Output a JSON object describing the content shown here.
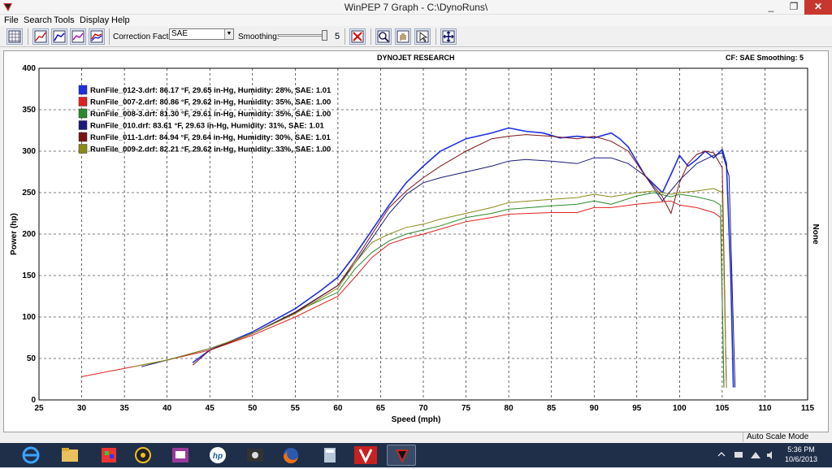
{
  "window": {
    "title": "WinPEP 7     Graph - C:\\DynoRuns\\",
    "min_glyph": "_",
    "max_glyph": "❐",
    "close_glyph": "✕"
  },
  "menu": [
    "File",
    "Search",
    "Tools",
    "Display",
    "Help"
  ],
  "toolbar": {
    "correction_label": "Correction Factor:",
    "correction_value": "SAE",
    "smoothing_label": "Smoothing:",
    "smoothing_value": "5"
  },
  "graph_header": {
    "center": "DYNOJET RESEARCH",
    "right": "CF: SAE  Smoothing: 5",
    "right_axis_label": "None"
  },
  "status": {
    "mode": "Auto Scale Mode"
  },
  "tray": {
    "time": "5:36 PM",
    "date": "10/6/2013"
  },
  "colors": {
    "blue": "#1e2ee0",
    "red": "#e02020",
    "green": "#2a8a2a",
    "navy": "#1a1a7a",
    "maroon": "#7a1414",
    "olive": "#8a8a18"
  },
  "icons": [
    "grid-icon",
    "graph-icon",
    "graph-icon",
    "graph-icon",
    "graph-icon",
    "delete-icon",
    "zoom-icon",
    "hand-icon",
    "cursor-icon",
    "move-icon"
  ],
  "chart_data": {
    "type": "line",
    "title": "",
    "xlabel": "Speed (mph)",
    "ylabel": "Power (hp)",
    "xlim": [
      25,
      115
    ],
    "ylim": [
      0,
      400
    ],
    "x_ticks": [
      25,
      30,
      35,
      40,
      45,
      50,
      55,
      60,
      65,
      70,
      75,
      80,
      85,
      90,
      95,
      100,
      105,
      110,
      115
    ],
    "y_ticks": [
      0,
      50,
      100,
      150,
      200,
      250,
      300,
      350,
      400
    ],
    "grid": true,
    "legend_position": "top-left",
    "series": [
      {
        "name": "RunFile_012-3.drf: 86.17 °F, 29.65 in-Hg, Humidity: 28%, SAE: 1.01",
        "color": "#1e2ee0",
        "x": [
          43,
          45,
          50,
          55,
          58,
          60,
          62,
          64,
          66,
          68,
          70,
          72,
          75,
          78,
          80,
          82,
          84,
          86,
          88,
          90,
          92,
          93,
          94,
          96,
          98,
          99,
          100,
          101,
          102,
          103,
          104,
          105,
          105.5,
          106,
          106.3
        ],
        "y": [
          45,
          60,
          82,
          110,
          132,
          148,
          175,
          205,
          235,
          262,
          282,
          300,
          315,
          322,
          328,
          324,
          322,
          316,
          318,
          316,
          322,
          315,
          305,
          270,
          250,
          272,
          295,
          282,
          290,
          300,
          292,
          302,
          285,
          150,
          15
        ]
      },
      {
        "name": "RunFile_007-2.drf: 80.86 °F, 29.62 in-Hg, Humidity: 35%, SAE: 1.00",
        "color": "#e02020",
        "x": [
          30,
          35,
          40,
          45,
          50,
          55,
          60,
          62,
          64,
          66,
          68,
          70,
          72,
          75,
          78,
          80,
          85,
          88,
          90,
          92,
          95,
          97,
          99,
          100,
          102,
          104,
          104.8,
          105.2
        ],
        "y": [
          28,
          38,
          48,
          60,
          78,
          100,
          125,
          148,
          172,
          188,
          195,
          200,
          206,
          215,
          220,
          224,
          226,
          226,
          232,
          232,
          236,
          238,
          240,
          235,
          232,
          226,
          220,
          15
        ]
      },
      {
        "name": "RunFile_008-3.drf: 81.30 °F, 29.61 in-Hg, Humidity: 35%, SAE: 1.00",
        "color": "#2a8a2a",
        "x": [
          37,
          40,
          45,
          50,
          55,
          60,
          62,
          64,
          66,
          68,
          70,
          72,
          75,
          78,
          80,
          85,
          88,
          90,
          92,
          95,
          97,
          99,
          100,
          102,
          104,
          104.8,
          105.2
        ],
        "y": [
          42,
          48,
          62,
          80,
          106,
          130,
          158,
          178,
          192,
          200,
          205,
          210,
          220,
          225,
          230,
          234,
          236,
          240,
          236,
          246,
          250,
          245,
          248,
          245,
          240,
          235,
          15
        ]
      },
      {
        "name": "RunFile_010.drf: 83.61 °F, 29.63 in-Hg, Humidity: 31%, SAE: 1.01",
        "color": "#1a1a7a",
        "x": [
          37,
          40,
          45,
          50,
          55,
          60,
          62,
          64,
          66,
          68,
          70,
          72,
          75,
          78,
          80,
          82,
          85,
          88,
          90,
          92,
          94,
          96,
          98,
          100,
          102,
          104,
          105,
          105.8,
          106.5
        ],
        "y": [
          40,
          48,
          62,
          80,
          106,
          138,
          165,
          195,
          225,
          248,
          262,
          268,
          275,
          282,
          288,
          290,
          288,
          285,
          292,
          292,
          285,
          270,
          240,
          265,
          285,
          295,
          298,
          270,
          15
        ]
      },
      {
        "name": "RunFile_011-1.drf: 84.94 °F, 29.64 in-Hg, Humidity: 30%, SAE: 1.01",
        "color": "#7a1414",
        "x": [
          43,
          45,
          50,
          55,
          60,
          62,
          64,
          66,
          68,
          70,
          72,
          75,
          78,
          80,
          82,
          85,
          88,
          90,
          92,
          94,
          96,
          98,
          99,
          100,
          101,
          102,
          103,
          104,
          105,
          105.5
        ],
        "y": [
          42,
          60,
          80,
          105,
          138,
          168,
          200,
          232,
          252,
          268,
          282,
          300,
          315,
          318,
          320,
          318,
          315,
          318,
          312,
          300,
          270,
          245,
          225,
          262,
          285,
          296,
          300,
          298,
          280,
          15
        ]
      },
      {
        "name": "RunFile_009-2.drf: 82.21 °F, 29.62 in-Hg, Humidity: 33%, SAE: 1.00",
        "color": "#8a8a18",
        "x": [
          36,
          40,
          45,
          50,
          55,
          60,
          62,
          64,
          66,
          68,
          70,
          72,
          75,
          78,
          80,
          85,
          88,
          90,
          92,
          95,
          97,
          99,
          100,
          102,
          104,
          105,
          105.5
        ],
        "y": [
          40,
          48,
          62,
          80,
          104,
          135,
          165,
          190,
          200,
          208,
          212,
          218,
          225,
          232,
          238,
          242,
          244,
          248,
          245,
          250,
          252,
          248,
          250,
          252,
          255,
          250,
          15
        ]
      }
    ]
  }
}
